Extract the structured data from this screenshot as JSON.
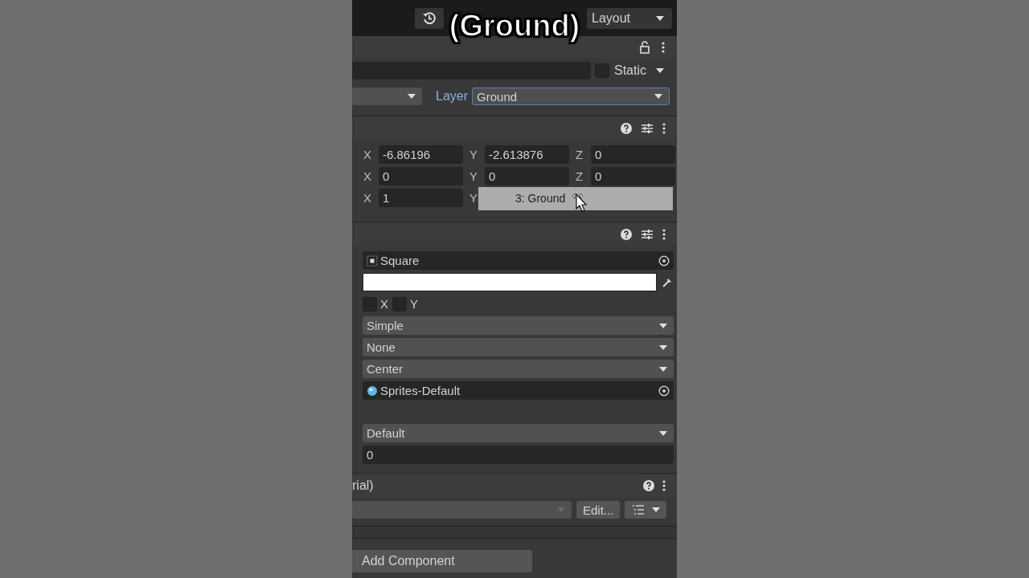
{
  "caption": "(Ground)",
  "toolbar": {
    "layout": "Layout"
  },
  "header": {
    "locked": false
  },
  "gameobject": {
    "static": {
      "label": "Static",
      "checked": false
    },
    "layer": {
      "label": "Layer",
      "value": "Ground",
      "focused": true
    }
  },
  "transform": {
    "rows": [
      {
        "fields": [
          {
            "axis": "X",
            "value": "-6.86196"
          },
          {
            "axis": "Y",
            "value": "-2.613876"
          },
          {
            "axis": "Z",
            "value": "0"
          }
        ]
      },
      {
        "fields": [
          {
            "axis": "X",
            "value": "0"
          },
          {
            "axis": "Y",
            "value": "0"
          },
          {
            "axis": "Z",
            "value": "0"
          }
        ]
      },
      {
        "fields": [
          {
            "axis": "X",
            "value": "1"
          },
          {
            "axis": "Y"
          }
        ]
      }
    ]
  },
  "drag_ghost": {
    "label": "3: Ground"
  },
  "sprite_renderer": {
    "rows": [
      {
        "kind": "sprite",
        "value": "Square"
      },
      {
        "kind": "color",
        "color": "#ffffff"
      },
      {
        "kind": "flip",
        "options": [
          {
            "label": "X",
            "checked": false
          },
          {
            "label": "Y",
            "checked": false
          }
        ]
      },
      {
        "kind": "dropdown",
        "value": "Simple"
      },
      {
        "kind": "dropdown",
        "value": "None"
      },
      {
        "kind": "dropdown",
        "value": "Center"
      },
      {
        "kind": "material",
        "value": "Sprites-Default"
      },
      {
        "kind": "spacer"
      },
      {
        "kind": "dropdown",
        "value": "Default"
      },
      {
        "kind": "number",
        "value": "0"
      }
    ]
  },
  "material": {
    "title": "rial)",
    "edit_button": "Edit..."
  },
  "add_component": "Add Component"
}
